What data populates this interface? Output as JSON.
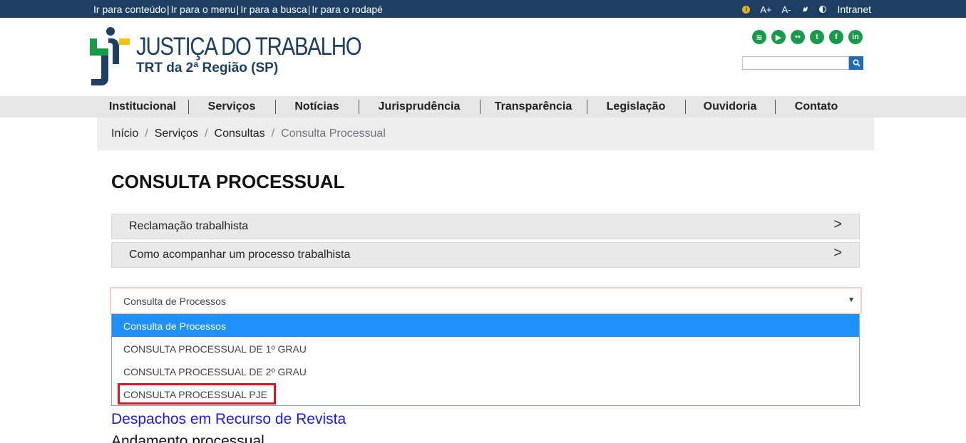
{
  "topbar": {
    "skip_links": [
      "Ir para conteúdo",
      "Ir para o menu",
      "Ir para a busca",
      "Ir para o rodapé"
    ],
    "separator": "|",
    "tools": {
      "info": "i",
      "font_increase": "A+",
      "font_decrease": "A-",
      "contrast_label": "",
      "intranet": "Intranet"
    }
  },
  "header": {
    "logo_title": "JUSTIÇA DO TRABALHO",
    "logo_subtitle": "TRT da 2ª Região (SP)",
    "social_icons": [
      "rss-icon",
      "youtube-icon",
      "flickr-icon",
      "twitter-icon",
      "facebook-icon",
      "linkedin-icon"
    ],
    "social_glyphs": [
      "≋",
      "▶",
      "••",
      "t",
      "f",
      "in"
    ],
    "search_placeholder": ""
  },
  "nav": {
    "items": [
      "Institucional",
      "Serviços",
      "Notícias",
      "Jurisprudência",
      "Transparência",
      "Legislação",
      "Ouvidoria",
      "Contato"
    ]
  },
  "breadcrumb": {
    "items": [
      "Início",
      "Serviços",
      "Consultas"
    ],
    "current": "Consulta Processual",
    "separator": "/"
  },
  "main": {
    "title": "CONSULTA PROCESSUAL",
    "accordions": [
      {
        "label": "Reclamação trabalhista",
        "arrow": ">"
      },
      {
        "label": "Como acompanhar um processo trabalhista",
        "arrow": ">"
      }
    ],
    "select": {
      "value": "Consulta de Processos",
      "caret": "▼",
      "options": [
        "Consulta de Processos",
        "CONSULTA PROCESSUAL DE 1º GRAU",
        "CONSULTA PROCESSUAL DE 2º GRAU",
        "CONSULTA PROCESSUAL PJE"
      ]
    },
    "link_despachos": "Despachos em Recurso de Revista",
    "andamento": "Andamento processual"
  },
  "colors": {
    "topbar": "#1c3f63",
    "social": "#179b4b",
    "selected_option": "#1e90ff",
    "highlight": "#e0141e",
    "link": "#1a1aee"
  }
}
